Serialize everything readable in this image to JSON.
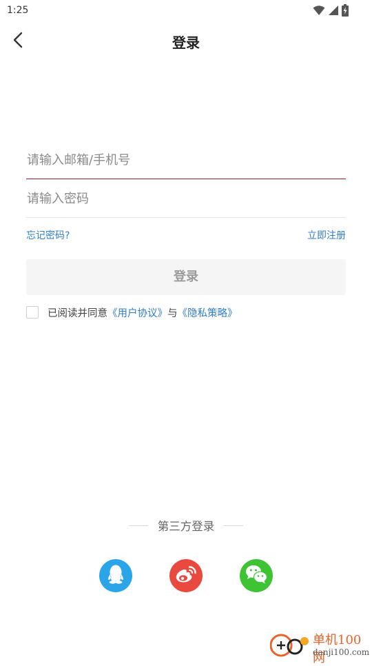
{
  "status_bar": {
    "time": "1:25",
    "icons": [
      "wifi-icon",
      "signal-icon",
      "battery-charging-icon"
    ]
  },
  "header": {
    "back_icon": "chevron-left-icon",
    "title": "登录"
  },
  "form": {
    "account_placeholder": "请输入邮箱/手机号",
    "account_value": "",
    "password_placeholder": "请输入密码",
    "password_value": "",
    "forgot_password": "忘记密码?",
    "register": "立即注册",
    "login_button": "登录"
  },
  "agreement": {
    "checked": false,
    "prefix": "已阅读并同意",
    "user_agreement": "《用户协议》",
    "conjunction": "与",
    "privacy_policy": "《隐私策略》"
  },
  "third_party": {
    "label": "第三方登录",
    "providers": [
      {
        "name": "qq",
        "icon": "qq-icon",
        "color": "#2aa6e8"
      },
      {
        "name": "weibo",
        "icon": "weibo-icon",
        "color": "#e94a3f"
      },
      {
        "name": "wechat",
        "icon": "wechat-icon",
        "color": "#3ec335"
      }
    ]
  },
  "watermark": {
    "title": "单机100网",
    "url": "danji100.com"
  },
  "colors": {
    "accent_underline": "#a01c2a",
    "link": "#2f7dc8"
  }
}
